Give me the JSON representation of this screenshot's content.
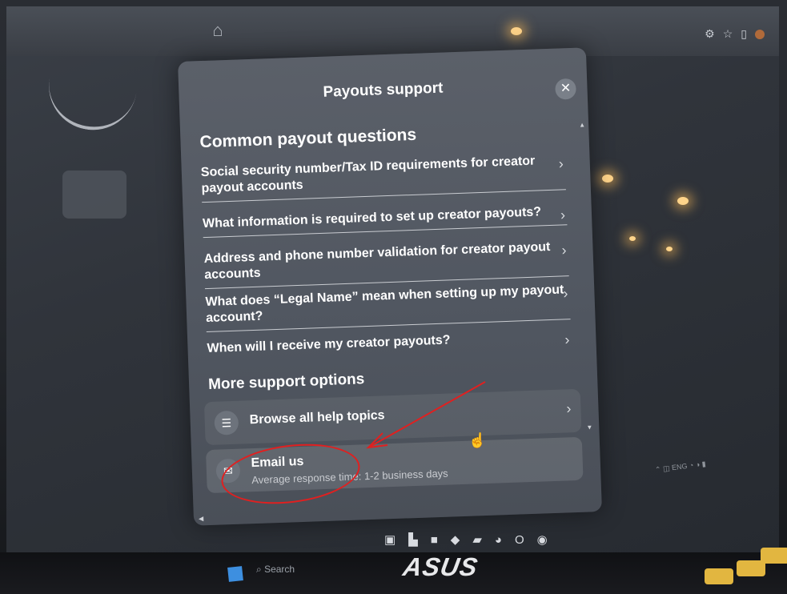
{
  "modal": {
    "title": "Payouts support",
    "close_icon": "close-icon",
    "common_heading": "Common payout questions",
    "questions": [
      {
        "label": "Social security number/Tax ID requirements for creator payout accounts"
      },
      {
        "label": "What information is required to set up creator payouts?"
      },
      {
        "label": "Address and phone number validation for creator payout accounts"
      },
      {
        "label": "What does “Legal Name” mean when setting up my payout account?"
      },
      {
        "label": "When will I receive my creator payouts?"
      }
    ],
    "more_heading": "More support options",
    "options": [
      {
        "label": "Browse all help topics",
        "subtitle": "",
        "icon": "list-icon"
      },
      {
        "label": "Email us",
        "subtitle": "Average response time: 1-2 business days",
        "icon": "email-icon"
      }
    ]
  },
  "taskbar": {
    "search_placeholder": "Search"
  },
  "laptop": {
    "brand": "ASUS"
  },
  "colors": {
    "annotation": "#e02020",
    "modal_bg": "#555a63"
  }
}
